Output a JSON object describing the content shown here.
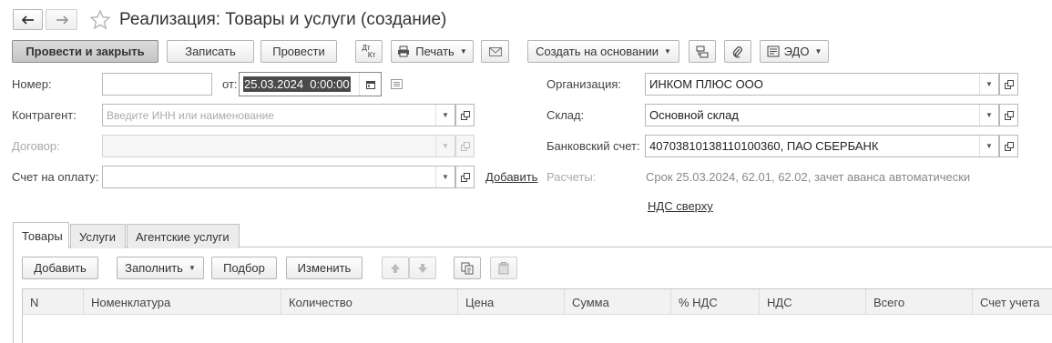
{
  "window": {
    "title": "Реализация: Товары и услуги (создание)"
  },
  "toolbar": {
    "post_close": "Провести и закрыть",
    "save": "Записать",
    "post": "Провести",
    "dt_kt_top": "Дт",
    "dt_kt_bottom": "Кт",
    "print": "Печать",
    "create_based": "Создать на основании",
    "edo": "ЭДО"
  },
  "form": {
    "number_label": "Номер:",
    "number_value": "",
    "date_from_label": "от:",
    "date_value": "25.03.2024  0:00:00",
    "counterparty_label": "Контрагент:",
    "counterparty_placeholder": "Введите ИНН или наименование",
    "contract_label": "Договор:",
    "invoice_label": "Счет на оплату:",
    "invoice_add_link": "Добавить",
    "organization_label": "Организация:",
    "organization_value": "ИНКОМ ПЛЮС ООО",
    "warehouse_label": "Склад:",
    "warehouse_value": "Основной склад",
    "bank_account_label": "Банковский счет:",
    "bank_account_value": "40703810138110100360, ПАО СБЕРБАНК",
    "settlements_label": "Расчеты:",
    "settlements_value": "Срок 25.03.2024, 62.01, 62.02, зачет аванса автоматически",
    "vat_link": "НДС сверху"
  },
  "tabs": [
    {
      "label": "Товары",
      "active": true
    },
    {
      "label": "Услуги",
      "active": false
    },
    {
      "label": "Агентские услуги",
      "active": false
    }
  ],
  "table_toolbar": {
    "add": "Добавить",
    "fill": "Заполнить",
    "pick": "Подбор",
    "change": "Изменить"
  },
  "table": {
    "columns": [
      "N",
      "Номенклатура",
      "Количество",
      "Цена",
      "Сумма",
      "% НДС",
      "НДС",
      "Всего",
      "Счет учета"
    ]
  },
  "colors": {
    "primary_button": "#c8c8c8",
    "border": "#b8b8b8",
    "date_highlight": "#4a4a4a"
  }
}
